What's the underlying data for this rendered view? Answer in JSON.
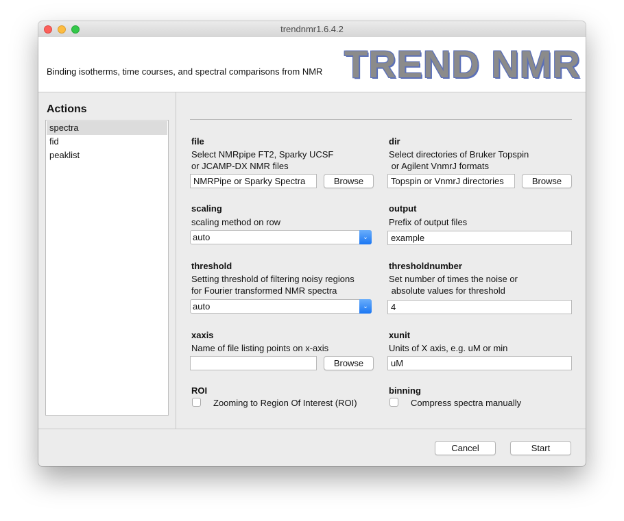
{
  "window": {
    "title": "trendnmr1.6.4.2"
  },
  "banner": {
    "description": "Binding isotherms, time courses, and spectral comparisons from NMR",
    "logo": "TREND NMR"
  },
  "sidebar": {
    "title": "Actions",
    "items": [
      {
        "label": "spectra",
        "selected": true
      },
      {
        "label": "fid"
      },
      {
        "label": "peaklist"
      }
    ]
  },
  "form": {
    "file": {
      "label": "file",
      "desc1": "Select NMRpipe FT2, Sparky UCSF",
      "desc2": "or JCAMP-DX NMR files",
      "value": "NMRPipe or Sparky Spectra",
      "button": "Browse"
    },
    "dir": {
      "label": "dir",
      "desc1": "Select directories of Bruker Topspin",
      "desc2": " or Agilent VnmrJ formats",
      "value": "Topspin or VnmrJ directories",
      "button": "Browse"
    },
    "scaling": {
      "label": "scaling",
      "desc": "scaling method on row",
      "value": "auto"
    },
    "output": {
      "label": "output",
      "desc": "Prefix of output files",
      "value": "example"
    },
    "threshold": {
      "label": "threshold",
      "desc1": "Setting threshold of filtering noisy regions",
      "desc2": "for Fourier transformed NMR spectra",
      "value": "auto"
    },
    "thresholdnumber": {
      "label": "thresholdnumber",
      "desc1": "Set number of times the noise or",
      "desc2": " absolute values for threshold",
      "value": "4"
    },
    "xaxis": {
      "label": "xaxis",
      "desc": "Name of file listing points on x-axis",
      "value": "",
      "button": "Browse"
    },
    "xunit": {
      "label": "xunit",
      "desc": "Units of X axis, e.g. uM or min",
      "value": "uM"
    },
    "roi": {
      "label": "ROI",
      "option": "Zooming to Region Of Interest (ROI)",
      "checked": false
    },
    "binning": {
      "label": "binning",
      "option": "Compress spectra manually",
      "checked": false
    }
  },
  "footer": {
    "cancel": "Cancel",
    "start": "Start"
  }
}
